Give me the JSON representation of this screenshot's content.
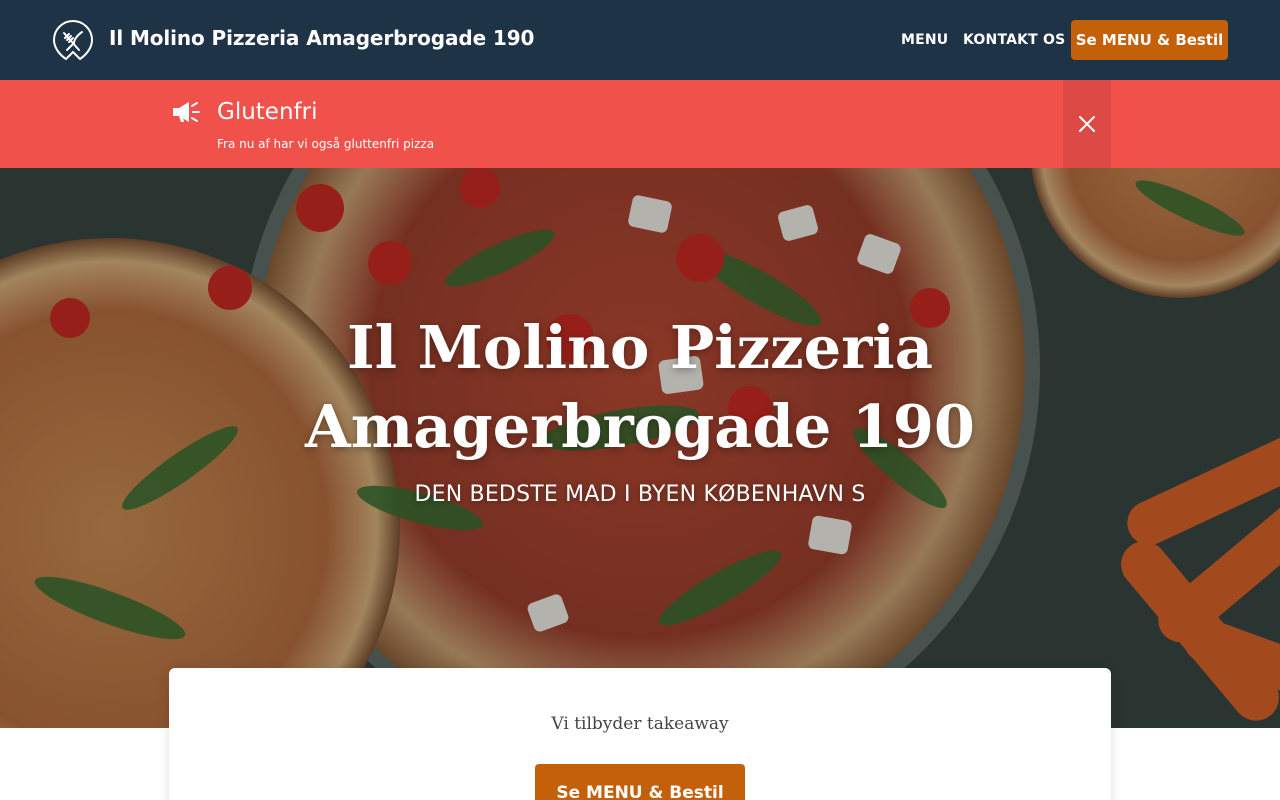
{
  "header": {
    "brand": "Il Molino Pizzeria Amagerbrogade 190",
    "logo_icon": "fork-knife-icon",
    "nav": [
      {
        "label": "MENU"
      },
      {
        "label": "KONTAKT OS"
      }
    ],
    "cta_label": "Se MENU & Bestil",
    "colors": {
      "background": "#1f3347",
      "cta": "#c45f0a"
    }
  },
  "announcement": {
    "icon": "megaphone-icon",
    "title": "Glutenfri",
    "text": "Fra nu af har vi også gluttenfri pizza",
    "close_icon": "close-icon",
    "color": "#f0514b"
  },
  "hero": {
    "title_line1": "Il Molino Pizzeria",
    "title_line2": "Amagerbrogade 190",
    "subtitle": "DEN BEDSTE MAD I BYEN KØBENHAVN S",
    "background": "pizza-photo"
  },
  "card": {
    "text": "Vi tilbyder takeaway",
    "button_label": "Se MENU & Bestil"
  }
}
